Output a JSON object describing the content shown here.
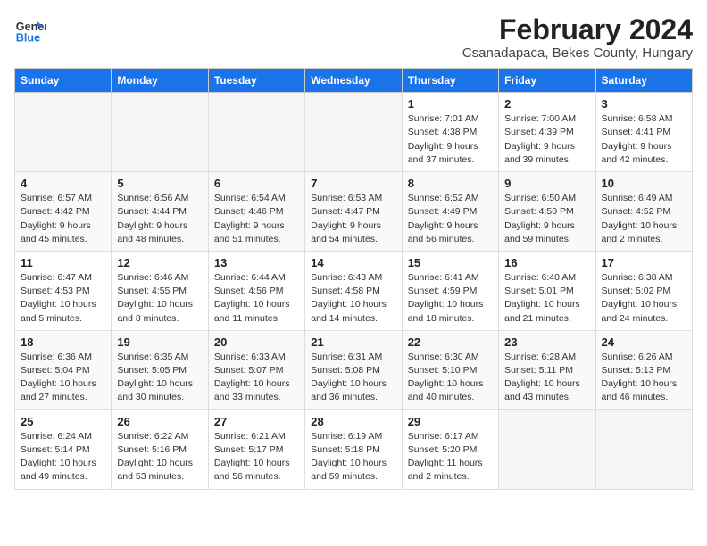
{
  "header": {
    "logo_line1": "General",
    "logo_line2": "Blue",
    "title": "February 2024",
    "subtitle": "Csanadapaca, Bekes County, Hungary"
  },
  "days_of_week": [
    "Sunday",
    "Monday",
    "Tuesday",
    "Wednesday",
    "Thursday",
    "Friday",
    "Saturday"
  ],
  "weeks": [
    [
      {
        "day": "",
        "info": ""
      },
      {
        "day": "",
        "info": ""
      },
      {
        "day": "",
        "info": ""
      },
      {
        "day": "",
        "info": ""
      },
      {
        "day": "1",
        "info": "Sunrise: 7:01 AM\nSunset: 4:38 PM\nDaylight: 9 hours\nand 37 minutes."
      },
      {
        "day": "2",
        "info": "Sunrise: 7:00 AM\nSunset: 4:39 PM\nDaylight: 9 hours\nand 39 minutes."
      },
      {
        "day": "3",
        "info": "Sunrise: 6:58 AM\nSunset: 4:41 PM\nDaylight: 9 hours\nand 42 minutes."
      }
    ],
    [
      {
        "day": "4",
        "info": "Sunrise: 6:57 AM\nSunset: 4:42 PM\nDaylight: 9 hours\nand 45 minutes."
      },
      {
        "day": "5",
        "info": "Sunrise: 6:56 AM\nSunset: 4:44 PM\nDaylight: 9 hours\nand 48 minutes."
      },
      {
        "day": "6",
        "info": "Sunrise: 6:54 AM\nSunset: 4:46 PM\nDaylight: 9 hours\nand 51 minutes."
      },
      {
        "day": "7",
        "info": "Sunrise: 6:53 AM\nSunset: 4:47 PM\nDaylight: 9 hours\nand 54 minutes."
      },
      {
        "day": "8",
        "info": "Sunrise: 6:52 AM\nSunset: 4:49 PM\nDaylight: 9 hours\nand 56 minutes."
      },
      {
        "day": "9",
        "info": "Sunrise: 6:50 AM\nSunset: 4:50 PM\nDaylight: 9 hours\nand 59 minutes."
      },
      {
        "day": "10",
        "info": "Sunrise: 6:49 AM\nSunset: 4:52 PM\nDaylight: 10 hours\nand 2 minutes."
      }
    ],
    [
      {
        "day": "11",
        "info": "Sunrise: 6:47 AM\nSunset: 4:53 PM\nDaylight: 10 hours\nand 5 minutes."
      },
      {
        "day": "12",
        "info": "Sunrise: 6:46 AM\nSunset: 4:55 PM\nDaylight: 10 hours\nand 8 minutes."
      },
      {
        "day": "13",
        "info": "Sunrise: 6:44 AM\nSunset: 4:56 PM\nDaylight: 10 hours\nand 11 minutes."
      },
      {
        "day": "14",
        "info": "Sunrise: 6:43 AM\nSunset: 4:58 PM\nDaylight: 10 hours\nand 14 minutes."
      },
      {
        "day": "15",
        "info": "Sunrise: 6:41 AM\nSunset: 4:59 PM\nDaylight: 10 hours\nand 18 minutes."
      },
      {
        "day": "16",
        "info": "Sunrise: 6:40 AM\nSunset: 5:01 PM\nDaylight: 10 hours\nand 21 minutes."
      },
      {
        "day": "17",
        "info": "Sunrise: 6:38 AM\nSunset: 5:02 PM\nDaylight: 10 hours\nand 24 minutes."
      }
    ],
    [
      {
        "day": "18",
        "info": "Sunrise: 6:36 AM\nSunset: 5:04 PM\nDaylight: 10 hours\nand 27 minutes."
      },
      {
        "day": "19",
        "info": "Sunrise: 6:35 AM\nSunset: 5:05 PM\nDaylight: 10 hours\nand 30 minutes."
      },
      {
        "day": "20",
        "info": "Sunrise: 6:33 AM\nSunset: 5:07 PM\nDaylight: 10 hours\nand 33 minutes."
      },
      {
        "day": "21",
        "info": "Sunrise: 6:31 AM\nSunset: 5:08 PM\nDaylight: 10 hours\nand 36 minutes."
      },
      {
        "day": "22",
        "info": "Sunrise: 6:30 AM\nSunset: 5:10 PM\nDaylight: 10 hours\nand 40 minutes."
      },
      {
        "day": "23",
        "info": "Sunrise: 6:28 AM\nSunset: 5:11 PM\nDaylight: 10 hours\nand 43 minutes."
      },
      {
        "day": "24",
        "info": "Sunrise: 6:26 AM\nSunset: 5:13 PM\nDaylight: 10 hours\nand 46 minutes."
      }
    ],
    [
      {
        "day": "25",
        "info": "Sunrise: 6:24 AM\nSunset: 5:14 PM\nDaylight: 10 hours\nand 49 minutes."
      },
      {
        "day": "26",
        "info": "Sunrise: 6:22 AM\nSunset: 5:16 PM\nDaylight: 10 hours\nand 53 minutes."
      },
      {
        "day": "27",
        "info": "Sunrise: 6:21 AM\nSunset: 5:17 PM\nDaylight: 10 hours\nand 56 minutes."
      },
      {
        "day": "28",
        "info": "Sunrise: 6:19 AM\nSunset: 5:18 PM\nDaylight: 10 hours\nand 59 minutes."
      },
      {
        "day": "29",
        "info": "Sunrise: 6:17 AM\nSunset: 5:20 PM\nDaylight: 11 hours\nand 2 minutes."
      },
      {
        "day": "",
        "info": ""
      },
      {
        "day": "",
        "info": ""
      }
    ]
  ]
}
